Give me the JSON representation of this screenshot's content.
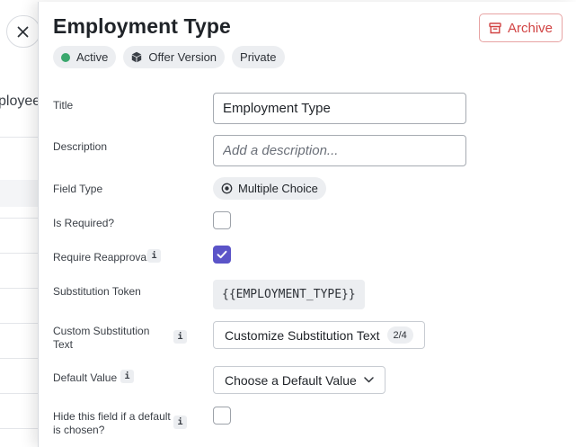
{
  "background": {
    "heading_partial": "ployee"
  },
  "drawer": {
    "title": "Employment Type",
    "archive_label": "Archive",
    "badges": {
      "status": "Active",
      "offer_version": "Offer Version",
      "visibility": "Private"
    },
    "fields": {
      "title": {
        "label": "Title",
        "value": "Employment Type"
      },
      "description": {
        "label": "Description",
        "placeholder": "Add a description..."
      },
      "field_type": {
        "label": "Field Type",
        "value": "Multiple Choice"
      },
      "is_required": {
        "label": "Is Required?",
        "checked": false
      },
      "require_reapproval": {
        "label": "Require Reapproval",
        "checked": true
      },
      "substitution_token": {
        "label": "Substitution Token",
        "value": "{{EMPLOYMENT_TYPE}}"
      },
      "custom_substitution_text": {
        "label": "Custom Substitution Text",
        "button_label": "Customize Substitution Text",
        "count": "2/4"
      },
      "default_value": {
        "label": "Default Value",
        "button_label": "Choose a Default Value"
      },
      "hide_if_default": {
        "label": "Hide this field if a default is chosen?",
        "checked": false
      }
    },
    "info_glyph": "i"
  },
  "colors": {
    "accent": "#5b54c8",
    "danger": "#d14343",
    "active": "#3aa76d"
  }
}
